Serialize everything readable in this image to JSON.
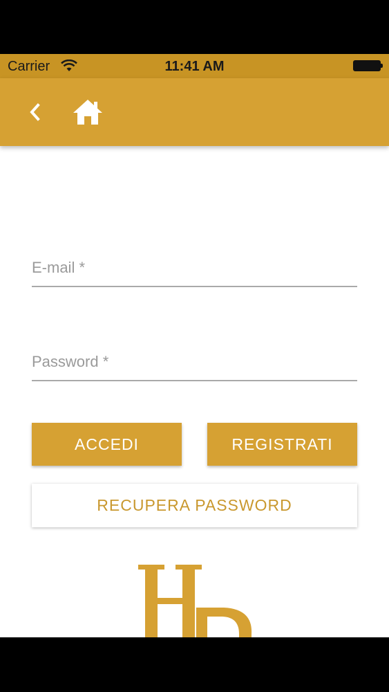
{
  "status_bar": {
    "carrier": "Carrier",
    "time": "11:41 AM"
  },
  "app_bar": {
    "back_icon": "chevron-left-icon",
    "home_icon": "home-icon"
  },
  "form": {
    "email_placeholder": "E-mail *",
    "email_value": "",
    "password_placeholder": "Password *",
    "password_value": "",
    "login_label": "ACCEDI",
    "register_label": "REGISTRATI",
    "recover_label": "RECUPERA PASSWORD"
  },
  "logo": {
    "text": "HB"
  },
  "colors": {
    "accent": "#d6a133",
    "status_bar": "#c89424",
    "link_text": "#c9982e"
  }
}
